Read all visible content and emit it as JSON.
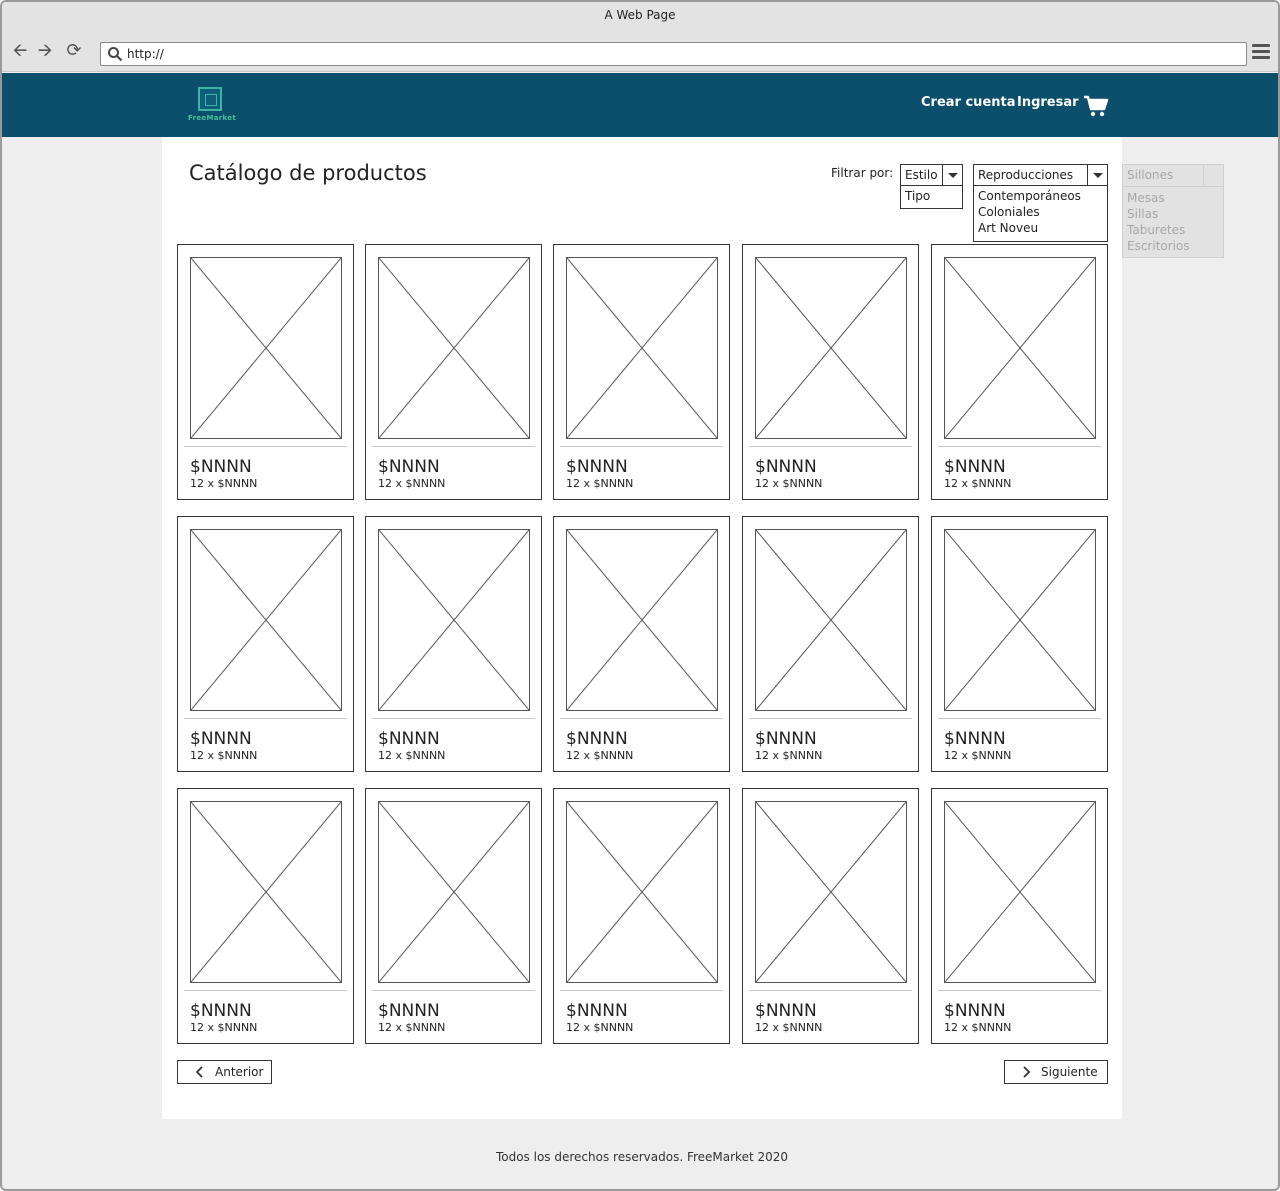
{
  "browser": {
    "title": "A Web Page",
    "url": "http://"
  },
  "header": {
    "logo_text": "FreeMarket",
    "create_account": "Crear cuenta",
    "login": "Ingresar"
  },
  "catalog": {
    "title": "Catálogo de productos",
    "filter_label": "Filtrar por:",
    "filter_type": {
      "selected": "Estilo",
      "options": [
        "Tipo"
      ]
    },
    "filter_value": {
      "selected": "Reproducciones",
      "options": [
        "Contemporáneos",
        "Coloniales",
        "Art Noveu"
      ]
    },
    "disabled_list": {
      "selected": "Sillones",
      "options": [
        "Mesas",
        "Sillas",
        "Taburetes",
        "Escritorios"
      ]
    },
    "products": [
      {
        "price": "$NNNN",
        "installments": "12 x $NNNN"
      },
      {
        "price": "$NNNN",
        "installments": "12 x $NNNN"
      },
      {
        "price": "$NNNN",
        "installments": "12 x $NNNN"
      },
      {
        "price": "$NNNN",
        "installments": "12 x $NNNN"
      },
      {
        "price": "$NNNN",
        "installments": "12 x $NNNN"
      },
      {
        "price": "$NNNN",
        "installments": "12 x $NNNN"
      },
      {
        "price": "$NNNN",
        "installments": "12 x $NNNN"
      },
      {
        "price": "$NNNN",
        "installments": "12 x $NNNN"
      },
      {
        "price": "$NNNN",
        "installments": "12 x $NNNN"
      },
      {
        "price": "$NNNN",
        "installments": "12 x $NNNN"
      },
      {
        "price": "$NNNN",
        "installments": "12 x $NNNN"
      },
      {
        "price": "$NNNN",
        "installments": "12 x $NNNN"
      },
      {
        "price": "$NNNN",
        "installments": "12 x $NNNN"
      },
      {
        "price": "$NNNN",
        "installments": "12 x $NNNN"
      },
      {
        "price": "$NNNN",
        "installments": "12 x $NNNN"
      }
    ],
    "prev_label": "Anterior",
    "next_label": "Siguiente"
  },
  "footer": {
    "text": "Todos los derechos reservados. FreeMarket 2020"
  },
  "colors": {
    "header_bg": "#0b4f6c",
    "logo_accent": "#3fb3a8"
  }
}
